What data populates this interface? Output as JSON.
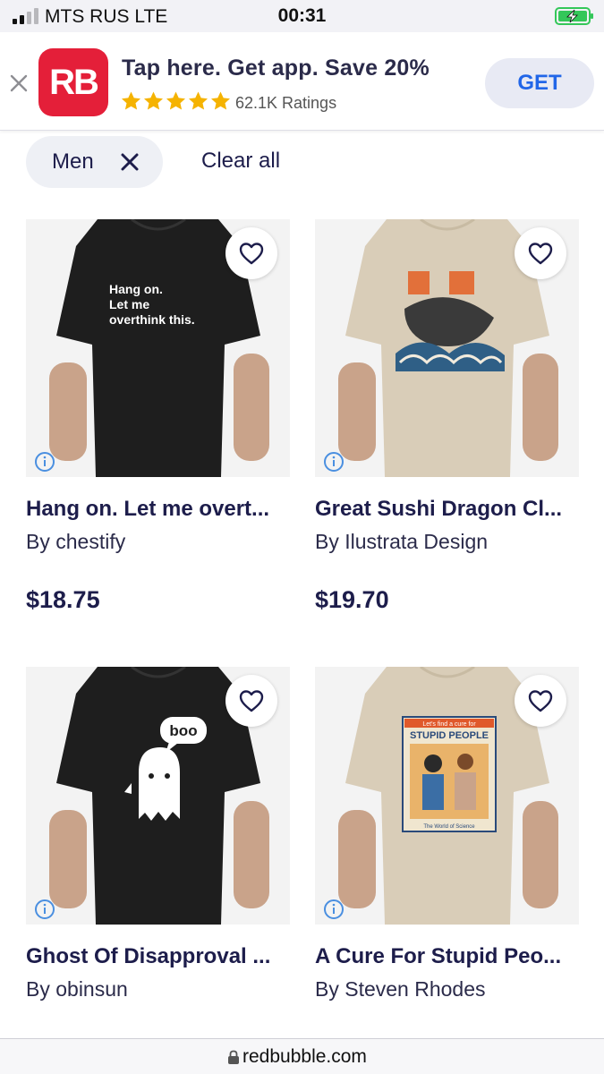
{
  "status_bar": {
    "carrier": "MTS RUS  LTE",
    "time": "00:31",
    "battery_color": "#34c759"
  },
  "app_banner": {
    "logo_text": "RB",
    "title": "Tap here. Get app. Save 20%",
    "rating_stars": 5,
    "ratings_text": "62.1K Ratings",
    "get_label": "GET",
    "logo_color": "#e41f39",
    "star_color": "#f5b301"
  },
  "filters": {
    "active_chip": "Men",
    "clear_label": "Clear all"
  },
  "products": [
    {
      "title": "Hang on. Let me overt...",
      "artist": "By chestify",
      "price": "$18.75",
      "shirt_color": "#1e1e1e",
      "print_text": [
        "Hang on.",
        "Let me",
        "overthink this."
      ]
    },
    {
      "title": "Great Sushi Dragon Cl...",
      "artist": "By Ilustrata Design",
      "price": "$19.70",
      "shirt_color": "#d9cdb8",
      "print_text": []
    },
    {
      "title": "Ghost Of Disapproval ...",
      "artist": "By obinsun",
      "price": "",
      "shirt_color": "#1e1e1e",
      "print_text": [
        "boo"
      ]
    },
    {
      "title": "A Cure For Stupid Peo...",
      "artist": "By Steven Rhodes",
      "price": "",
      "shirt_color": "#d9cdb8",
      "print_text": [
        "Let's find a cure for",
        "STUPID PEOPLE",
        "The World of Science"
      ]
    }
  ],
  "browser": {
    "url": "redbubble.com"
  }
}
